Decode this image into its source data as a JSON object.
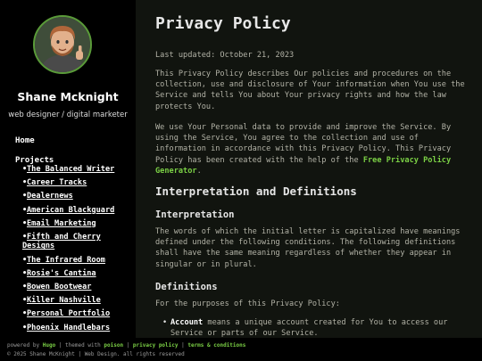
{
  "profile": {
    "name": "Shane Mcknight",
    "tagline": "web designer / digital marketer"
  },
  "nav": {
    "home": "Home",
    "projects": "Projects",
    "projects_list": [
      "The Balanced Writer",
      "Career Tracks",
      "Dealernews",
      "American Blackguard",
      "Email Marketing",
      "Fifth and Cherry Designs",
      "The Infrared Room",
      "Rosie's Cantina",
      "Bowen Bootwear",
      "Killer Nashville",
      "Personal Portfolio",
      "Phoenix Handlebars"
    ]
  },
  "content": {
    "title": "Privacy Policy",
    "last_updated": "Last updated: October 21, 2023",
    "para1": "This Privacy Policy describes Our policies and procedures on the collection, use and disclosure of Your information when You use the Service and tells You about Your privacy rights and how the law protects You.",
    "para2_pre": "We use Your Personal data to provide and improve the Service. By using the Service, You agree to the collection and use of information in accordance with this Privacy Policy. This Privacy Policy has been created with the help of the ",
    "para2_link": "Free Privacy Policy Generator",
    "para2_post": ".",
    "h_interp_def": "Interpretation and Definitions",
    "h_interp": "Interpretation",
    "para_interp": "The words of which the initial letter is capitalized have meanings defined under the following conditions. The following definitions shall have the same meaning regardless of whether they appear in singular or in plural.",
    "h_defs": "Definitions",
    "para_defs": "For the purposes of this Privacy Policy:",
    "def1_term": "Account",
    "def1_text": " means a unique account created for You to access our Service or parts of our Service."
  },
  "footer": {
    "powered_by": "powered by ",
    "hugo": "Hugo",
    "themed_with": " | themed with ",
    "poison": "poison",
    "sep1": " | ",
    "privacy": "privacy policy",
    "sep2": " | ",
    "terms": "terms & conditions",
    "copyright": "© 2025 Shane McKnight | Web Design. all rights reserved"
  },
  "colors": {
    "accent": "#7bd045",
    "main_bg": "#11140f",
    "sidebar_bg": "#000000",
    "body_text": "#b2b2a6"
  }
}
